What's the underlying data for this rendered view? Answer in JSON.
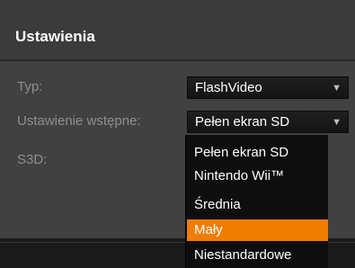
{
  "panel": {
    "title": "Ustawienia"
  },
  "fields": {
    "type": {
      "label": "Typ:",
      "value": "FlashVideo",
      "caret": "▼"
    },
    "preset": {
      "label": "Ustawienie wstępne:",
      "value": "Pełen ekran SD",
      "caret": "▼"
    },
    "s3d": {
      "label": "S3D:"
    }
  },
  "preset_dropdown": {
    "options": [
      "Pełen ekran SD",
      "Nintendo Wii™",
      "Średnia",
      "Mały",
      "Niestandardowe"
    ],
    "highlighted": "Mały"
  },
  "colors": {
    "highlight": "#f07d00",
    "panel_bg": "#414141",
    "label_text": "#8e8e8e"
  }
}
